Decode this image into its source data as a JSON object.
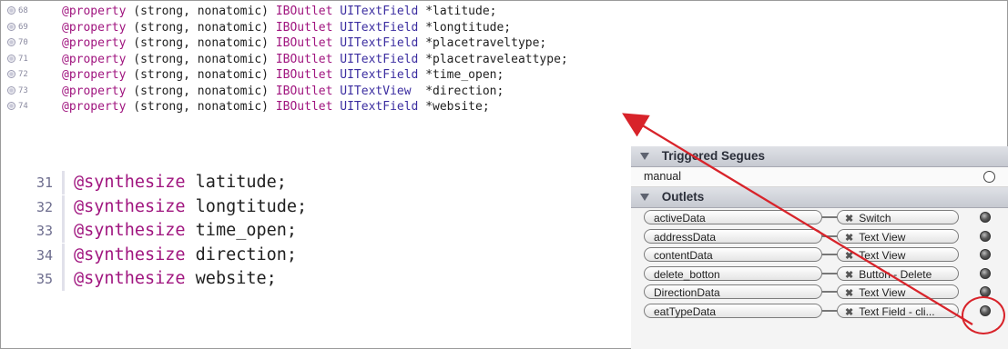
{
  "code_top": {
    "lines": [
      {
        "num": "68",
        "kw": "@property",
        "attrs": "(strong, nonatomic)",
        "outlet": "IBOutlet",
        "type": "UITextField",
        "name": "*latitude;"
      },
      {
        "num": "69",
        "kw": "@property",
        "attrs": "(strong, nonatomic)",
        "outlet": "IBOutlet",
        "type": "UITextField",
        "name": "*longtitude;"
      },
      {
        "num": "70",
        "kw": "@property",
        "attrs": "(strong, nonatomic)",
        "outlet": "IBOutlet",
        "type": "UITextField",
        "name": "*placetraveltype;"
      },
      {
        "num": "71",
        "kw": "@property",
        "attrs": "(strong, nonatomic)",
        "outlet": "IBOutlet",
        "type": "UITextField",
        "name": "*placetraveleattype;"
      },
      {
        "num": "72",
        "kw": "@property",
        "attrs": "(strong, nonatomic)",
        "outlet": "IBOutlet",
        "type": "UITextField",
        "name": "*time_open;"
      },
      {
        "num": "73",
        "kw": "@property",
        "attrs": "(strong, nonatomic)",
        "outlet": "IBOutlet",
        "type": "UITextView ",
        "name": "*direction;"
      },
      {
        "num": "74",
        "kw": "@property",
        "attrs": "(strong, nonatomic)",
        "outlet": "IBOutlet",
        "type": "UITextField",
        "name": "*website;"
      }
    ]
  },
  "code_bottom": {
    "lines": [
      {
        "num": "31",
        "kw": "@synthesize",
        "name": "latitude;"
      },
      {
        "num": "32",
        "kw": "@synthesize",
        "name": "longtitude;"
      },
      {
        "num": "33",
        "kw": "@synthesize",
        "name": "time_open;"
      },
      {
        "num": "34",
        "kw": "@synthesize",
        "name": "direction;"
      },
      {
        "num": "35",
        "kw": "@synthesize",
        "name": "website;"
      }
    ]
  },
  "inspector": {
    "triggered_segues_title": "Triggered Segues",
    "manual_label": "manual",
    "outlets_title": "Outlets",
    "outlets": [
      {
        "name": "activeData",
        "target": "Switch"
      },
      {
        "name": "addressData",
        "target": "Text View"
      },
      {
        "name": "contentData",
        "target": "Text View"
      },
      {
        "name": "delete_botton",
        "target": "Button - Delete"
      },
      {
        "name": "DirectionData",
        "target": "Text View"
      },
      {
        "name": "eatTypeData",
        "target": "Text Field - cli..."
      }
    ]
  },
  "colors": {
    "keyword": "#a0157f",
    "type": "#3b2da0",
    "arrow": "#d8232a"
  }
}
